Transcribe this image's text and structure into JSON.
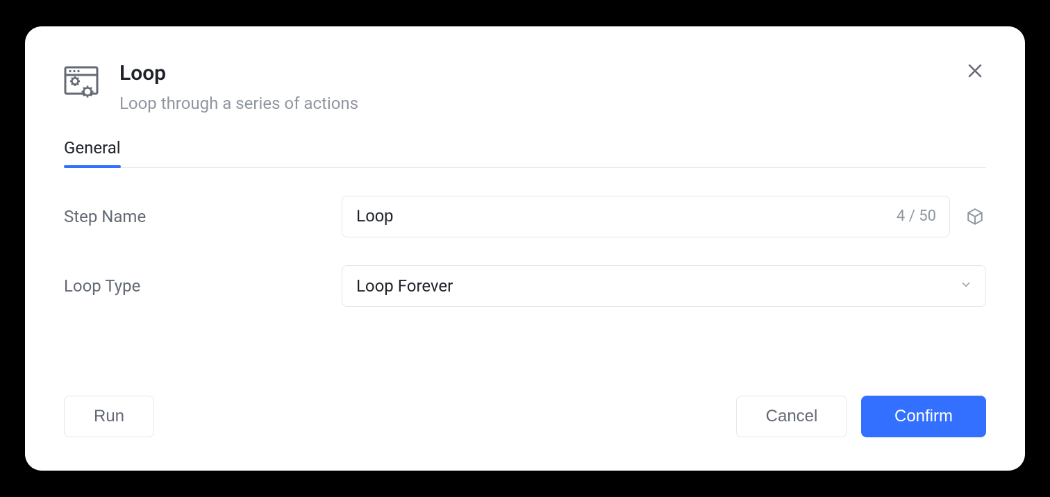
{
  "header": {
    "title": "Loop",
    "subtitle": "Loop through a series of actions"
  },
  "tabs": {
    "general": "General"
  },
  "form": {
    "stepName": {
      "label": "Step Name",
      "value": "Loop",
      "count": "4 / 50"
    },
    "loopType": {
      "label": "Loop Type",
      "value": "Loop Forever"
    }
  },
  "footer": {
    "run": "Run",
    "cancel": "Cancel",
    "confirm": "Confirm"
  }
}
